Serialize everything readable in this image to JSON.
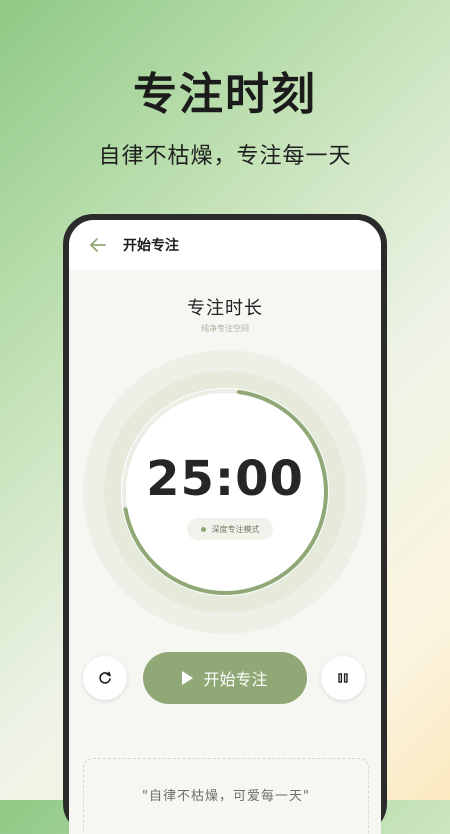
{
  "promo": {
    "title": "专注时刻",
    "subtitle": "自律不枯燥，专注每一天"
  },
  "topbar": {
    "back_icon": "arrow-left-icon",
    "title": "开始专注"
  },
  "focus": {
    "title": "专注时长",
    "subtitle": "纯净专注空间",
    "time": "25:00",
    "mode": "深度专注模式",
    "progress": 0.7
  },
  "controls": {
    "reset_icon": "refresh-icon",
    "start_label": "开始专注",
    "pause_icon": "pause-icon"
  },
  "quote": {
    "text": "\"自律不枯燥，可爱每一天\""
  },
  "colors": {
    "accent": "#8fa876",
    "ring": "#8fa876",
    "phone_frame": "#2b2b2b"
  }
}
